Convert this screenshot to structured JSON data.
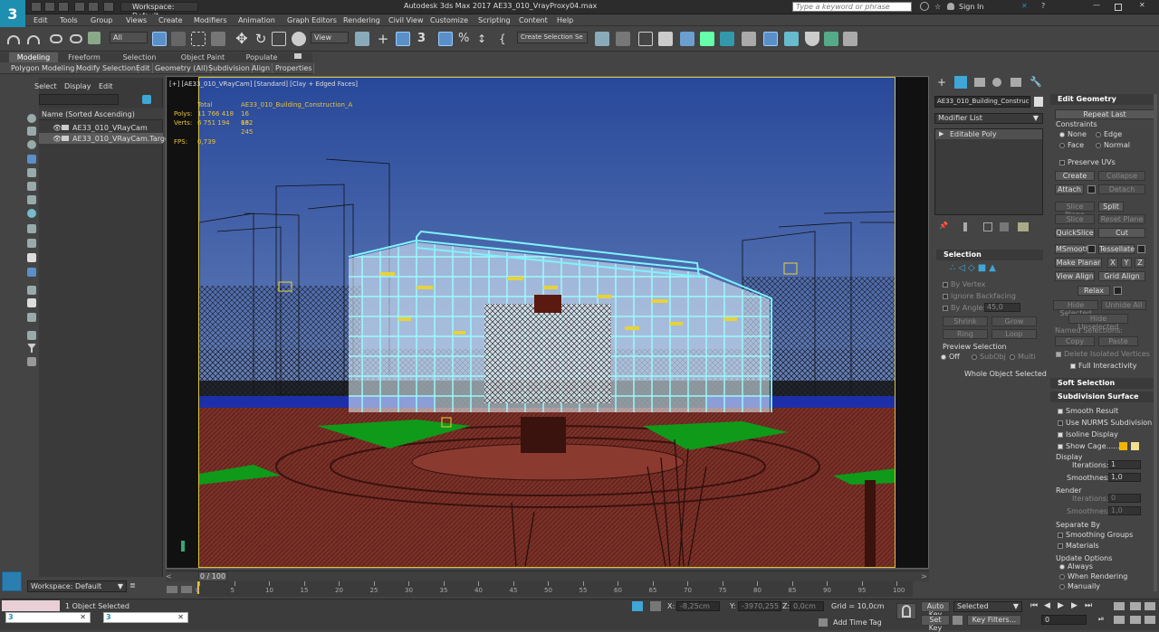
{
  "title_bar": {
    "workspace": "Workspace: Default",
    "app_title": "Autodesk 3ds Max 2017     AE33_010_VrayProxy04.max",
    "search_placeholder": "Type a keyword or phrase",
    "sign_in": "Sign In"
  },
  "logo": "3",
  "menu": [
    "Edit",
    "Tools",
    "Group",
    "Views",
    "Create",
    "Modifiers",
    "Animation",
    "Graph Editors",
    "Rendering",
    "Civil View",
    "Customize",
    "Scripting",
    "Content",
    "Help"
  ],
  "toolbar": {
    "filter": "All",
    "coord": "View",
    "selection_set": "Create Selection Se"
  },
  "ribbon": {
    "tabs": [
      "Modeling",
      "Freeform",
      "Selection",
      "Object Paint",
      "Populate"
    ],
    "buttons": [
      "Polygon Modeling",
      "Modify Selection",
      "Edit",
      "Geometry (All)",
      "Subdivision",
      "Align",
      "Properties"
    ]
  },
  "scene_explorer": {
    "menus": [
      "Select",
      "Display",
      "Edit"
    ],
    "column_header": "Name (Sorted Ascending)",
    "items": [
      "AE33_010_VRayCam",
      "AE33_010_VRayCam.Target"
    ]
  },
  "viewport": {
    "label": "[+] [AE33_010_VRayCam] [Standard] [Clay + Edged Faces]",
    "stats_header_total": "Total",
    "stats_header_obj": "AE33_010_Building_Construction_A",
    "polys_label": "Polys:",
    "polys_total": "11 766 418",
    "polys_obj": "16 692",
    "verts_label": "Verts:",
    "verts_total": "6 751 194",
    "verts_obj": "16 245",
    "fps_label": "FPS:",
    "fps": "0,739"
  },
  "command_panel": {
    "object_name": "AE33_010_Building_Constructio",
    "modifier_list": "Modifier List",
    "stack_item": "Editable Poly",
    "selection_title": "Selection",
    "by_vertex": "By Vertex",
    "ignore_backfacing": "Ignore Backfacing",
    "by_angle": "By Angle:",
    "angle_value": "45,0",
    "shrink": "Shrink",
    "grow": "Grow",
    "ring": "Ring",
    "loop": "Loop",
    "preview_selection": "Preview Selection",
    "preview_options": [
      "Off",
      "SubObj",
      "Multi"
    ],
    "whole_object": "Whole Object Selected"
  },
  "edit_geometry": {
    "title": "Edit Geometry",
    "repeat_last": "Repeat Last",
    "constraints": "Constraints",
    "constraint_options": [
      "None",
      "Edge",
      "Face",
      "Normal"
    ],
    "preserve_uvs": "Preserve UVs",
    "create": "Create",
    "collapse": "Collapse",
    "attach": "Attach",
    "detach": "Detach",
    "slice_plane": "Slice Plane",
    "split": "Split",
    "slice": "Slice",
    "reset_plane": "Reset Plane",
    "quickslice": "QuickSlice",
    "cut": "Cut",
    "msmooth": "MSmooth",
    "tessellate": "Tessellate",
    "make_planar": "Make Planar",
    "x": "X",
    "y": "Y",
    "z": "Z",
    "view_align": "View Align",
    "grid_align": "Grid Align",
    "relax": "Relax",
    "hide_selected": "Hide Selected",
    "unhide_all": "Unhide All",
    "hide_unselected": "Hide Unselected",
    "named_selections": "Named Selections:",
    "copy": "Copy",
    "paste": "Paste",
    "delete_isolated": "Delete Isolated Vertices",
    "full_interactivity": "Full Interactivity"
  },
  "soft_selection": {
    "title": "Soft Selection"
  },
  "subdivision_surface": {
    "title": "Subdivision Surface",
    "smooth_result": "Smooth Result",
    "use_nurms": "Use NURMS Subdivision",
    "isoline": "Isoline Display",
    "show_cage": "Show Cage......",
    "display": "Display",
    "iterations": "Iterations:",
    "iterations_value": "1",
    "smoothness": "Smoothness:",
    "smoothness_value": "1,0",
    "render": "Render",
    "r_iterations": "Iterations:",
    "r_iterations_value": "0",
    "r_smoothness": "Smoothness:",
    "r_smoothness_value": "1,0",
    "separate_by": "Separate By",
    "smoothing_groups": "Smoothing Groups",
    "materials": "Materials",
    "update_options": "Update Options",
    "update_choices": [
      "Always",
      "When Rendering",
      "Manually"
    ]
  },
  "timeline": {
    "frame": "0 / 100",
    "ticks": [
      "0",
      "5",
      "10",
      "15",
      "20",
      "25",
      "30",
      "35",
      "40",
      "45",
      "50",
      "55",
      "60",
      "65",
      "70",
      "75",
      "80",
      "85",
      "90",
      "95",
      "100"
    ]
  },
  "status": {
    "workspace": "Workspace: Default",
    "selected": "1 Object Selected",
    "x_label": "X:",
    "x": "-8,25cm",
    "y_label": "Y:",
    "y": "-3970,255",
    "z_label": "Z:",
    "z": "0,0cm",
    "grid": "Grid = 10,0cm",
    "add_time_tag": "Add Time Tag",
    "auto_key": "Auto Key",
    "selected_dropdown": "Selected",
    "set_key": "Set Key",
    "key_filters": "Key Filters...",
    "frame_field": "0"
  },
  "colors": {
    "sky_top": "#2a4d9c",
    "sky_bottom": "#8aa0c8",
    "ground": "#7a3028",
    "lawn": "#0f9a1a",
    "wire_selected": "#7ef3ff",
    "stats_yellow": "#e8c43a"
  }
}
